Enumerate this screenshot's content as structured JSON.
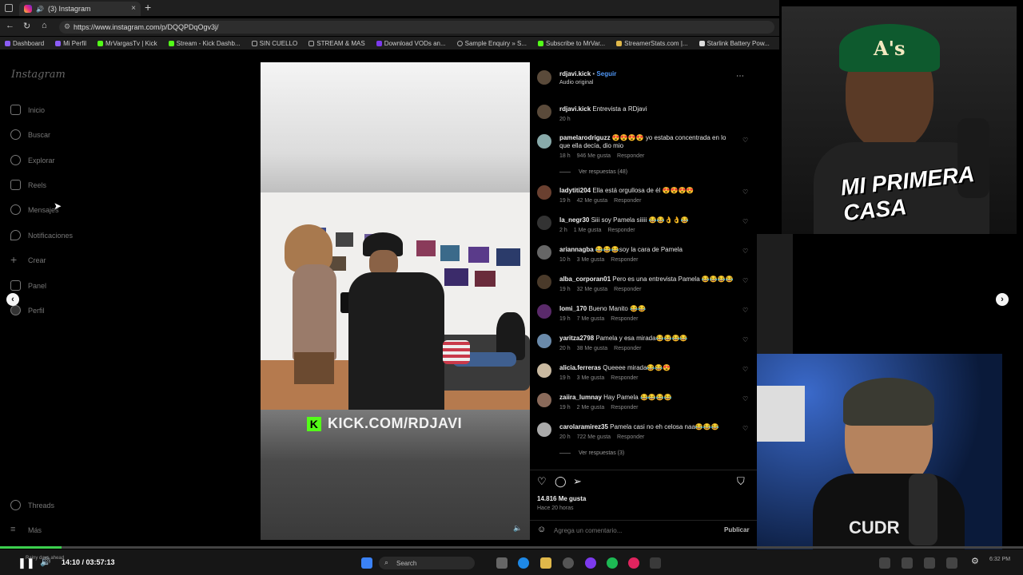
{
  "browser": {
    "tab_title": "(3) Instagram",
    "url": "https://www.instagram.com/p/DQQPDqOgv3j/",
    "bookmarks": [
      "Dashboard",
      "Mi Perfil",
      "MrVargasTv | Kick",
      "Stream - Kick Dashb...",
      "SIN CUELLO",
      "STREAM & MAS",
      "Download VODs an...",
      "Sample Enquiry » S...",
      "Subscribe to MrVar...",
      "StreamerStats.com |...",
      "Starlink Battery Pow..."
    ]
  },
  "instagram": {
    "logo": "Instagram",
    "nav": [
      {
        "label": "Inicio",
        "icon": "home-icon"
      },
      {
        "label": "Buscar",
        "icon": "search-icon"
      },
      {
        "label": "Explorar",
        "icon": "compass-icon"
      },
      {
        "label": "Reels",
        "icon": "reels-icon"
      },
      {
        "label": "Mensajes",
        "icon": "messenger-icon"
      },
      {
        "label": "Notificaciones",
        "icon": "heart-icon"
      },
      {
        "label": "Crear",
        "icon": "plus-icon"
      },
      {
        "label": "Panel",
        "icon": "chart-icon"
      },
      {
        "label": "Perfil",
        "icon": "avatar-icon"
      }
    ],
    "nav_bottom": [
      {
        "label": "Threads",
        "icon": "threads-icon"
      },
      {
        "label": "Más",
        "icon": "menu-icon"
      }
    ]
  },
  "post": {
    "author": "rdjavi.kick",
    "follow": "Seguir",
    "audio": "Audio original",
    "caption": "Entrevista a RDjavi",
    "caption_time": "20 h",
    "video_overlay": "KICK.COM/RDJAVI",
    "comments": [
      {
        "user": "pamelarodriguzz",
        "text": "😍😍😍😍 yo estaba concentrada en lo que ella decía, dio mio",
        "time": "18 h",
        "likes": "946 Me gusta",
        "reply": "Responder",
        "replies": "Ver respuestas (48)"
      },
      {
        "user": "ladytiti204",
        "text": "Ella está orgullosa de él 😍😍😍😍",
        "time": "19 h",
        "likes": "42 Me gusta",
        "reply": "Responder"
      },
      {
        "user": "la_negr30",
        "text": "Siii soy Pamela siiiii 😂😂👌👌😂",
        "time": "2 h",
        "likes": "1 Me gusta",
        "reply": "Responder"
      },
      {
        "user": "ariannagba",
        "text": "😂😂😂soy la cara de Pamela",
        "time": "10 h",
        "likes": "3 Me gusta",
        "reply": "Responder"
      },
      {
        "user": "alba_corporan01",
        "text": "Pero es una entrevista Pamela 😂😂😂😂",
        "time": "19 h",
        "likes": "32 Me gusta",
        "reply": "Responder"
      },
      {
        "user": "lomi_170",
        "text": "Bueno Manito 😂😂",
        "time": "19 h",
        "likes": "7 Me gusta",
        "reply": "Responder"
      },
      {
        "user": "yaritza2798",
        "text": "Pamela y esa mirada😂😂😂😂",
        "time": "20 h",
        "likes": "38 Me gusta",
        "reply": "Responder"
      },
      {
        "user": "alicia.ferreras",
        "text": "Queeee mirada😂😂😍",
        "time": "19 h",
        "likes": "3 Me gusta",
        "reply": "Responder"
      },
      {
        "user": "zaiira_lumnay",
        "text": "Hay Pamela 😂😂😂😂",
        "time": "19 h",
        "likes": "2 Me gusta",
        "reply": "Responder"
      },
      {
        "user": "carolaramirez35",
        "text": "Pamela casi no eh celosa naa😂😂😂",
        "time": "20 h",
        "likes": "722 Me gusta",
        "reply": "Responder",
        "replies": "Ver respuestas (3)"
      }
    ],
    "likes_total": "14.816 Me gusta",
    "posted": "Hace 20 horas",
    "comment_placeholder": "Agrega un comentario...",
    "publish": "Publicar"
  },
  "player": {
    "time": "14:10 / 03:57:13",
    "progress": 0.06,
    "weather": "Rainy days ahead"
  },
  "stream": {
    "overlay_text": "MI PRIMERA CASA",
    "shirt_text": "CUDR"
  },
  "taskbar": {
    "search": "Search",
    "clock": "6:32 PM"
  }
}
